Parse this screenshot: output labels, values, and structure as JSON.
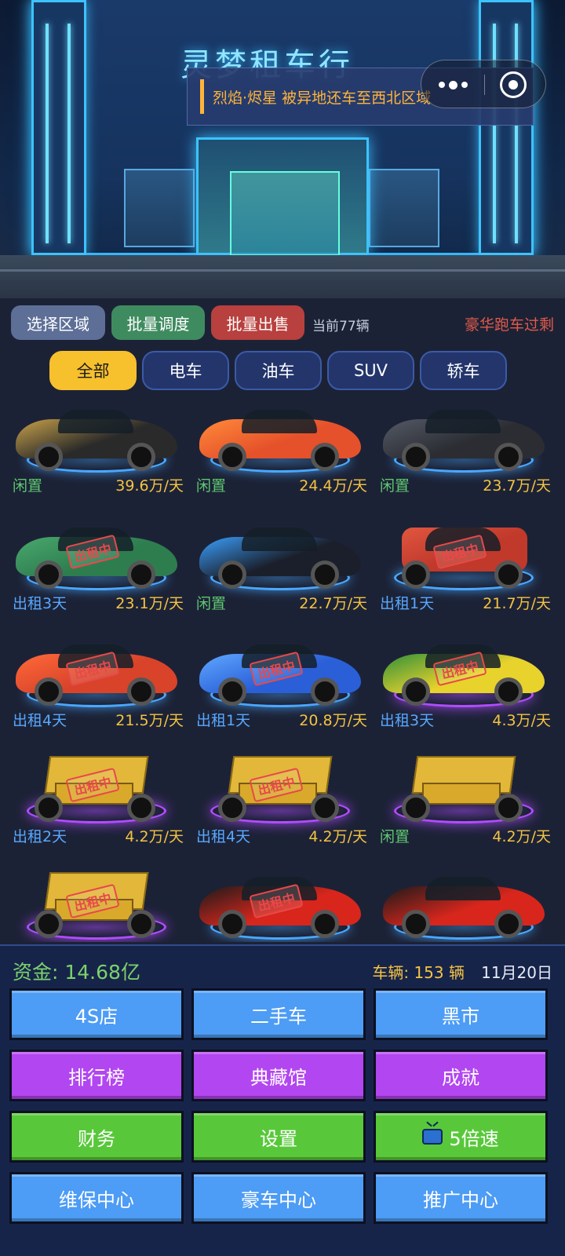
{
  "hero": {
    "sign": "灵梦租车行",
    "notice": "烈焰·烬星 被异地还车至西北区域"
  },
  "capsule": {
    "menu_icon": "more-dots-icon",
    "close_icon": "target-close-icon"
  },
  "toolbar": {
    "region_label": "选择区域",
    "dispatch_label": "批量调度",
    "sell_label": "批量出售",
    "count_text": "当前77辆",
    "alert_text": "豪华跑车过剩"
  },
  "tabs": [
    {
      "label": "全部",
      "active": true
    },
    {
      "label": "电车"
    },
    {
      "label": "油车"
    },
    {
      "label": "SUV"
    },
    {
      "label": "轿车"
    }
  ],
  "rented_stamp": "出租中",
  "cars": [
    {
      "status": "闲置",
      "price": "39.6万/天",
      "color": "#2a2a2a",
      "accent": "#c9a24a",
      "kind": "sport",
      "rented": false
    },
    {
      "status": "闲置",
      "price": "24.4万/天",
      "color": "#e5512a",
      "accent": "#ff8a3a",
      "kind": "sport",
      "rented": false
    },
    {
      "status": "闲置",
      "price": "23.7万/天",
      "color": "#2b2d33",
      "accent": "#555a66",
      "kind": "sport",
      "rented": false
    },
    {
      "status": "出租3天",
      "price": "23.1万/天",
      "color": "#2e7d4f",
      "accent": "#49a86d",
      "kind": "sport",
      "rented": true
    },
    {
      "status": "闲置",
      "price": "22.7万/天",
      "color": "#1b1f2b",
      "accent": "#3aa0ff",
      "kind": "sport",
      "rented": false
    },
    {
      "status": "出租1天",
      "price": "21.7万/天",
      "color": "#c0392b",
      "accent": "#e0563f",
      "kind": "suv",
      "rented": true
    },
    {
      "status": "出租4天",
      "price": "21.5万/天",
      "color": "#d8432a",
      "accent": "#ff6a3a",
      "kind": "sport",
      "rented": true
    },
    {
      "status": "出租1天",
      "price": "20.8万/天",
      "color": "#2a5fd8",
      "accent": "#5fa8ff",
      "kind": "sport",
      "rented": true
    },
    {
      "status": "出租3天",
      "price": "4.3万/天",
      "color": "#e8d22c",
      "accent": "#2f8f3a",
      "kind": "sport",
      "rented": true,
      "glow": "purple"
    },
    {
      "status": "出租2天",
      "price": "4.2万/天",
      "color": "#e2b73a",
      "accent": "#8a6a12",
      "kind": "truck",
      "rented": true,
      "glow": "purple"
    },
    {
      "status": "出租4天",
      "price": "4.2万/天",
      "color": "#e2b73a",
      "accent": "#8a6a12",
      "kind": "truck",
      "rented": true,
      "glow": "purple"
    },
    {
      "status": "闲置",
      "price": "4.2万/天",
      "color": "#e2b73a",
      "accent": "#8a6a12",
      "kind": "truck",
      "rented": false,
      "glow": "purple"
    },
    {
      "status": "",
      "price": "",
      "color": "#e2b73a",
      "accent": "#8a6a12",
      "kind": "truck",
      "rented": true,
      "glow": "purple"
    },
    {
      "status": "",
      "price": "",
      "color": "#d8261c",
      "accent": "#1a1a1a",
      "kind": "sport",
      "rented": true
    },
    {
      "status": "",
      "price": "",
      "color": "#d8261c",
      "accent": "#1a1a1a",
      "kind": "sport",
      "rented": false
    }
  ],
  "panel": {
    "money": "资金: 14.68亿",
    "vehicles": "车辆: 153 辆",
    "date": "11月20日",
    "buttons": [
      {
        "label": "4S店",
        "color": "blue"
      },
      {
        "label": "二手车",
        "color": "blue"
      },
      {
        "label": "黑市",
        "color": "blue"
      },
      {
        "label": "排行榜",
        "color": "purple"
      },
      {
        "label": "典藏馆",
        "color": "purple"
      },
      {
        "label": "成就",
        "color": "purple"
      },
      {
        "label": "财务",
        "color": "green"
      },
      {
        "label": "设置",
        "color": "green"
      },
      {
        "label": "5倍速",
        "color": "green",
        "icon": "tv-icon"
      },
      {
        "label": "维保中心",
        "color": "blue"
      },
      {
        "label": "豪车中心",
        "color": "blue"
      },
      {
        "label": "推广中心",
        "color": "blue"
      }
    ]
  }
}
